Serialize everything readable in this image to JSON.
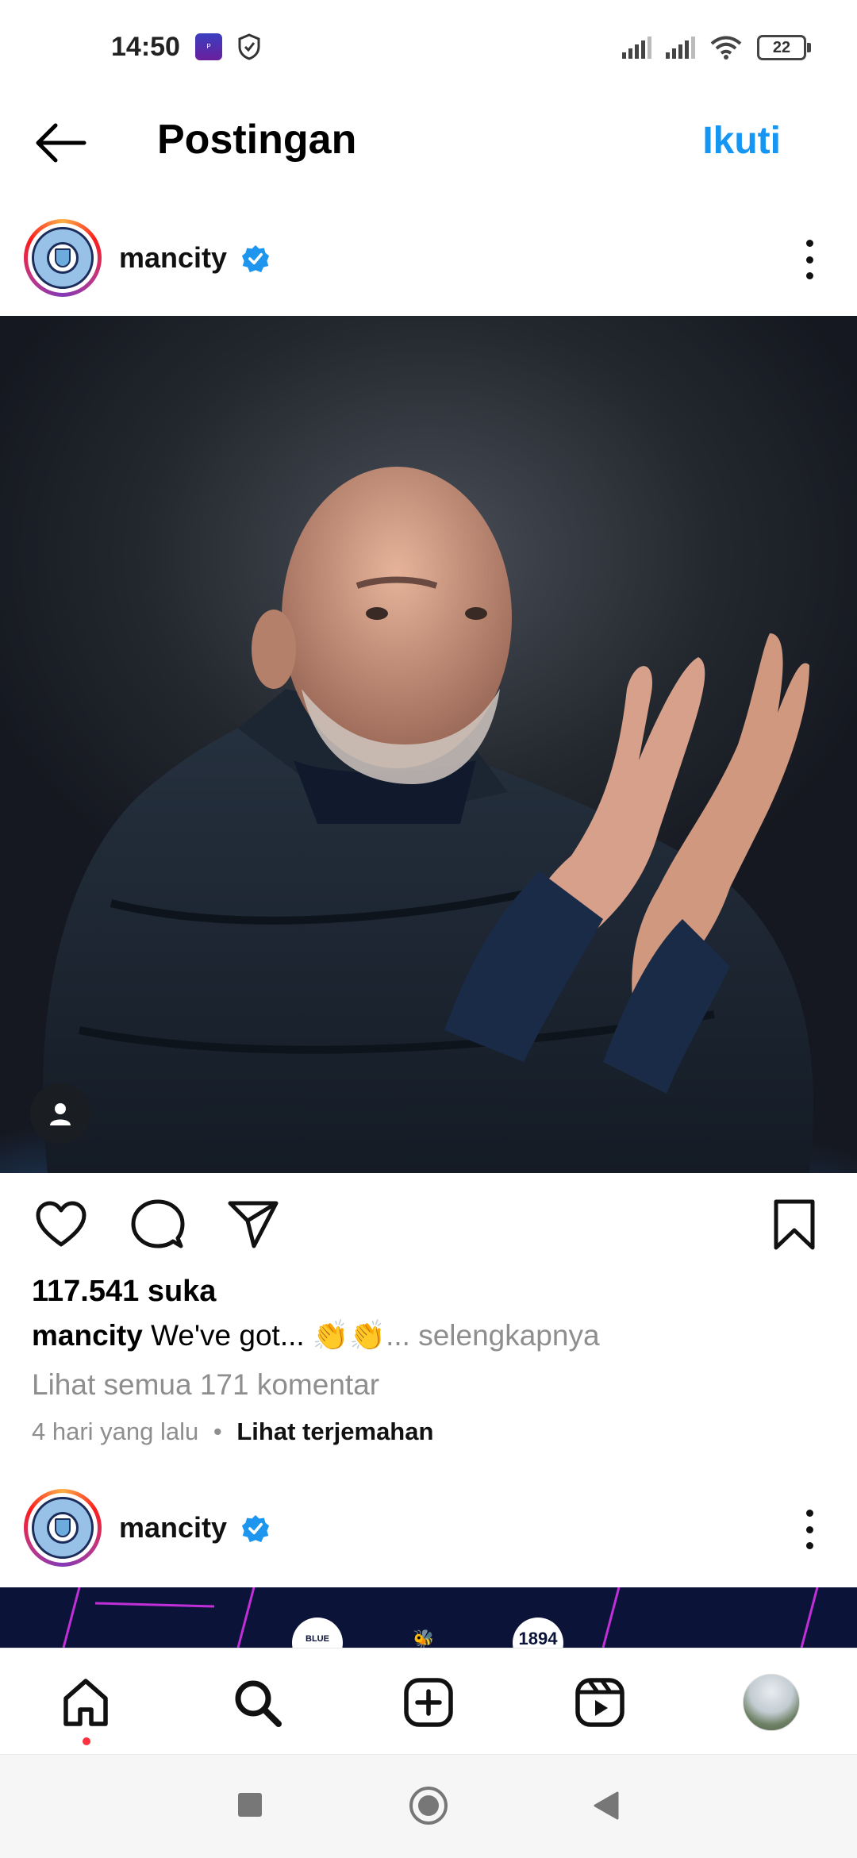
{
  "status_bar": {
    "time": "14:50",
    "icons": [
      "poster-app-icon",
      "shield-app-icon",
      "signal-icon",
      "signal-icon",
      "wifi-icon"
    ],
    "battery": "22"
  },
  "header": {
    "back_icon": "arrow-left-icon",
    "title": "Postingan",
    "follow_label": "Ikuti"
  },
  "post": {
    "username": "mancity",
    "verified": true,
    "likes": "117.541 suka",
    "caption_user": "mancity",
    "caption_text": "We've got... 👏👏",
    "caption_more": "... selengkapnya",
    "comments_link": "Lihat semua 171 komentar",
    "time_ago": "4 hari yang lalu",
    "separator": "•",
    "translate_label": "Lihat terjemahan"
  },
  "next_post": {
    "username": "mancity",
    "badges": [
      "BLUE MOON",
      "🐝",
      "1894"
    ]
  },
  "bottom_nav": [
    "home-icon",
    "search-icon",
    "create-icon",
    "reels-icon",
    "profile-avatar"
  ],
  "system_nav": [
    "recent-apps-icon",
    "home-circle-icon",
    "back-triangle-icon"
  ],
  "colors": {
    "accent": "#1596f3",
    "verified": "#1e96f0",
    "muted": "#8e8e8e",
    "notification_dot": "#ff3040"
  }
}
